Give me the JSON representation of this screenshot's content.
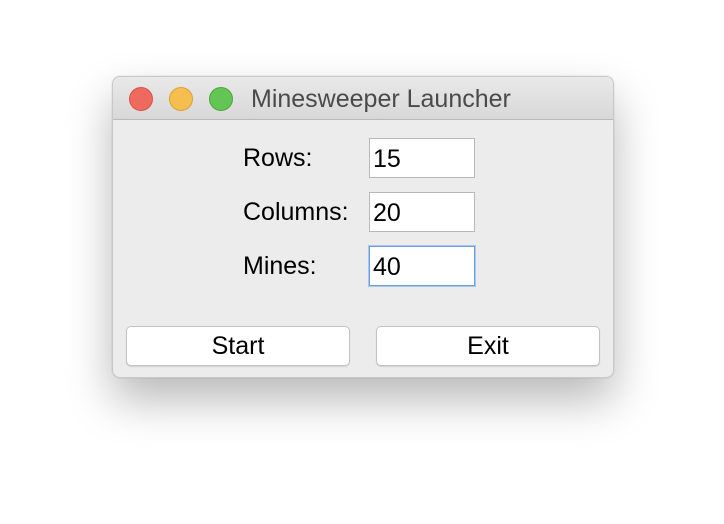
{
  "window": {
    "title": "Minesweeper Launcher"
  },
  "form": {
    "rows": {
      "label": "Rows:",
      "value": "15"
    },
    "columns": {
      "label": "Columns:",
      "value": "20"
    },
    "mines": {
      "label": "Mines:",
      "value": "40",
      "focused": true
    }
  },
  "buttons": {
    "start_label": "Start",
    "exit_label": "Exit"
  },
  "colors": {
    "close": "#ee6a5f",
    "minimize": "#f5be4f",
    "zoom": "#62c554",
    "focus_ring": "#6a9ee0"
  }
}
